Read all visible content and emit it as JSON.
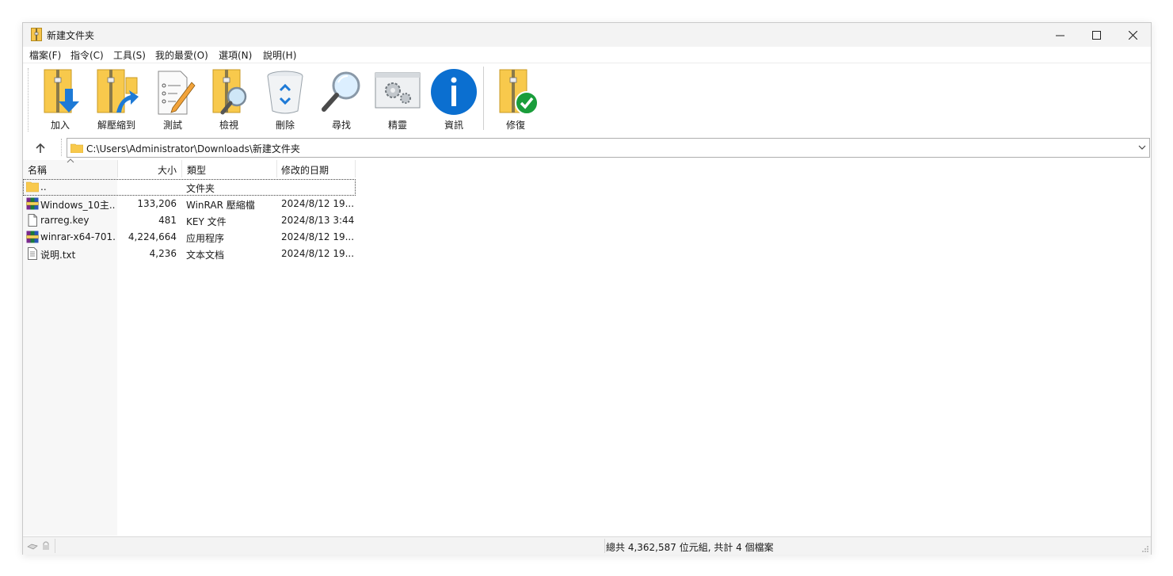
{
  "window": {
    "title": "新建文件夹",
    "controls": {
      "minimize": "minimize",
      "maximize": "maximize",
      "close": "close"
    }
  },
  "menu": [
    "檔案(F)",
    "指令(C)",
    "工具(S)",
    "我的最愛(O)",
    "選項(N)",
    "說明(H)"
  ],
  "toolbar": [
    {
      "label": "加入",
      "icon": "add-archive-icon"
    },
    {
      "label": "解壓縮到",
      "icon": "extract-to-icon"
    },
    {
      "label": "測試",
      "icon": "test-archive-icon"
    },
    {
      "label": "檢視",
      "icon": "view-icon"
    },
    {
      "label": "刪除",
      "icon": "recycle-bin-icon"
    },
    {
      "label": "尋找",
      "icon": "find-icon"
    },
    {
      "label": "精靈",
      "icon": "wizard-icon"
    },
    {
      "label": "資訊",
      "icon": "info-icon"
    },
    {
      "label": "修復",
      "icon": "repair-icon"
    }
  ],
  "address": {
    "path": "C:\\Users\\Administrator\\Downloads\\新建文件夹"
  },
  "columns": {
    "name": "名稱",
    "size": "大小",
    "type": "類型",
    "modified": "修改的日期"
  },
  "files": [
    {
      "name": "..",
      "size": "",
      "type": "文件夹",
      "modified": "",
      "icon": "folder-icon"
    },
    {
      "name": "Windows_10主...",
      "size": "133,206",
      "type": "WinRAR 壓縮檔",
      "modified": "2024/8/12 19...",
      "icon": "rar-archive-icon"
    },
    {
      "name": "rarreg.key",
      "size": "481",
      "type": "KEY 文件",
      "modified": "2024/8/13 3:44",
      "icon": "blank-file-icon"
    },
    {
      "name": "winrar-x64-701...",
      "size": "4,224,664",
      "type": "应用程序",
      "modified": "2024/8/12 19...",
      "icon": "winrar-exe-icon"
    },
    {
      "name": "说明.txt",
      "size": "4,236",
      "type": "文本文档",
      "modified": "2024/8/12 19...",
      "icon": "text-file-icon"
    }
  ],
  "status": {
    "summary": "總共 4,362,587 位元組, 共計 4 個檔案"
  },
  "colors": {
    "folder": "#f8c94c",
    "accent_blue": "#1e7ad6",
    "check_green": "#1a9d3b"
  }
}
